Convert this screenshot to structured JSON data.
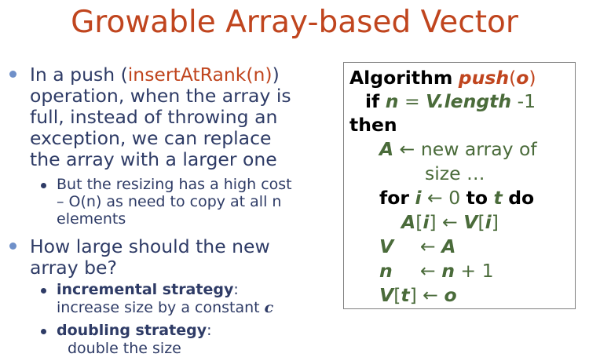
{
  "title": "Growable Array-based Vector",
  "bullets": {
    "b1": {
      "line1_pre": "In a push (",
      "line1_method": "insertAtRank(n)",
      "line1_post": ")",
      "line2": "operation, when the array is",
      "line3": "full, instead of throwing an",
      "line4": "exception, we can replace",
      "line5": "the array with a larger one",
      "sub1_line1": "But the resizing has a high cost",
      "sub1_line2": "– O(n) as need to copy at all n",
      "sub1_line3": "elements"
    },
    "b2": {
      "line1": "How large should the new",
      "line2": "array be?",
      "sub1_bold": "incremental strategy",
      "sub1_colon": ":",
      "sub1_line2": "increase size by a constant",
      "sub1_const": "c",
      "sub2_bold": "doubling strategy",
      "sub2_colon": ":",
      "sub2_line2": "double the size"
    }
  },
  "algorithm": {
    "kw_algorithm": "Algorithm",
    "name": "push",
    "lparen": "(",
    "param": "o",
    "rparen": ")",
    "kw_if": "if",
    "n": "n",
    "eq": "=",
    "vlength": "V.length",
    "minus1": "-1",
    "kw_then": "then",
    "A": "A",
    "arrow": "←",
    "new_array": "new array of",
    "size": "size …",
    "kw_for": "for",
    "i": "i",
    "zero": "0",
    "kw_to": "to",
    "t": "t",
    "kw_do": "do",
    "A_bracket_open": "[",
    "bracket_close": "]",
    "V": "V",
    "plus1": "+ 1"
  }
}
